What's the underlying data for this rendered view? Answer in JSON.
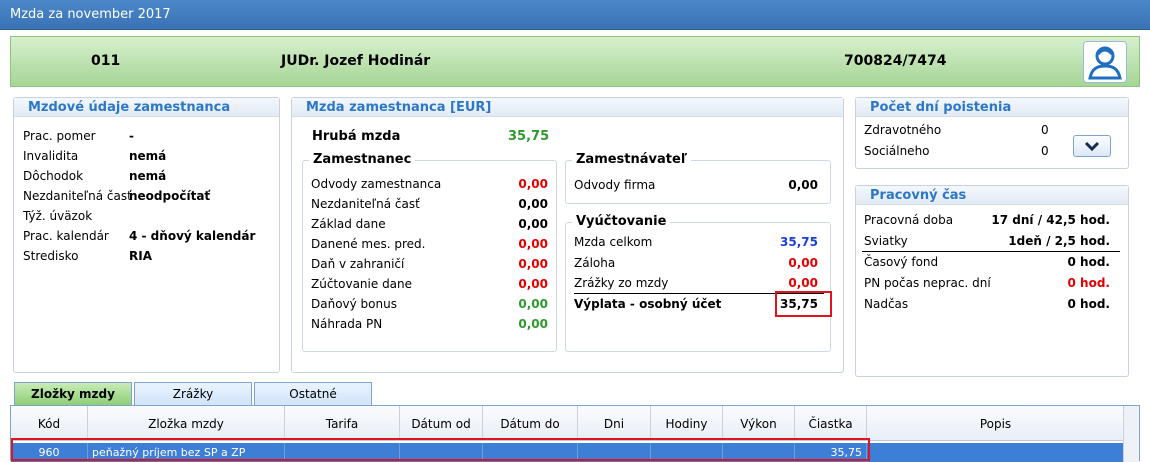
{
  "window": {
    "title": "Mzda za november 2017"
  },
  "header": {
    "code": "011",
    "name": "JUDr. Jozef Hodinár",
    "rc": "700824/7474"
  },
  "mzdove_udaje": {
    "title": "Mzdové údaje zamestnanca",
    "rows": [
      {
        "label": "Prac. pomer",
        "value": "-"
      },
      {
        "label": "Invalidita",
        "value": "nemá"
      },
      {
        "label": "Dôchodok",
        "value": "nemá"
      },
      {
        "label": "Nezdaniteľná časť",
        "value": "neodpočítať"
      },
      {
        "label": "Týž. úväzok",
        "value": ""
      },
      {
        "label": "Prac. kalendár",
        "value": "4 - dňový kalendár"
      },
      {
        "label": "Stredisko",
        "value": "RIA"
      }
    ]
  },
  "mzda": {
    "title": "Mzda zamestnanca [EUR]",
    "hruba_label": "Hrubá mzda",
    "hruba_value": "35,75",
    "zamestnanec": {
      "title": "Zamestnanec",
      "rows": [
        {
          "label": "Odvody zamestnanca",
          "value": "0,00"
        },
        {
          "label": "Nezdaniteľná časť",
          "value": "0,00"
        },
        {
          "label": "Základ dane",
          "value": "0,00"
        },
        {
          "label": "Danené mes. pred.",
          "value": "0,00"
        },
        {
          "label": "Daň v zahraničí",
          "value": "0,00"
        },
        {
          "label": "Zúčtovanie dane",
          "value": "0,00"
        },
        {
          "label": "Daňový bonus",
          "value": "0,00"
        },
        {
          "label": "Náhrada PN",
          "value": "0,00"
        }
      ]
    },
    "zamestnavatel": {
      "title": "Zamestnávateľ",
      "rows": [
        {
          "label": "Odvody firma",
          "value": "0,00"
        }
      ]
    },
    "vyuctovanie": {
      "title": "Vyúčtovanie",
      "rows": [
        {
          "label": "Mzda celkom",
          "value": "35,75"
        },
        {
          "label": "Záloha",
          "value": "0,00"
        },
        {
          "label": "Zrážky zo mzdy",
          "value": "0,00"
        }
      ],
      "total_label": "Výplata - osobný účet",
      "total_value": "35,75"
    }
  },
  "poistenie": {
    "title": "Počet dní poistenia",
    "rows": [
      {
        "label": "Zdravotného",
        "value": "0"
      },
      {
        "label": "Sociálneho",
        "value": "0"
      }
    ]
  },
  "pracovny_cas": {
    "title": "Pracovný čas",
    "rows": [
      {
        "label": "Pracovná doba",
        "value": "17 dní / 42,5 hod."
      },
      {
        "label": "Sviatky",
        "value": "1deň / 2,5 hod."
      },
      {
        "label": "Časový fond",
        "value": "0 hod."
      },
      {
        "label": "PN počas neprac. dní",
        "value": "0 hod."
      },
      {
        "label": "Nadčas",
        "value": "0 hod."
      }
    ]
  },
  "tabs": [
    {
      "label": "Zložky mzdy"
    },
    {
      "label": "Zrážky"
    },
    {
      "label": "Ostatné"
    }
  ],
  "grid": {
    "columns": [
      "Kód",
      "Zložka mzdy",
      "Tarifa",
      "Dátum od",
      "Dátum do",
      "Dni",
      "Hodiny",
      "Výkon",
      "Čiastka",
      "Popis"
    ],
    "rows": [
      {
        "kod": "960",
        "zlozka": "peňažný príjem bez SP a ZP",
        "tarifa": "",
        "datum_od": "",
        "datum_do": "",
        "dni": "",
        "hodiny": "",
        "vykon": "",
        "ciastka": "35,75",
        "popis": ""
      }
    ]
  },
  "colors": {
    "title_bar": "#3a73b5",
    "header_green": "#a6d596",
    "accent_blue": "#2c78c7",
    "negative_red": "#e30000",
    "highlight_red": "#e0141e",
    "row_selected": "#3d7ed6"
  },
  "icons": {
    "user": "user-icon",
    "dropdown": "chevron-down-icon"
  }
}
